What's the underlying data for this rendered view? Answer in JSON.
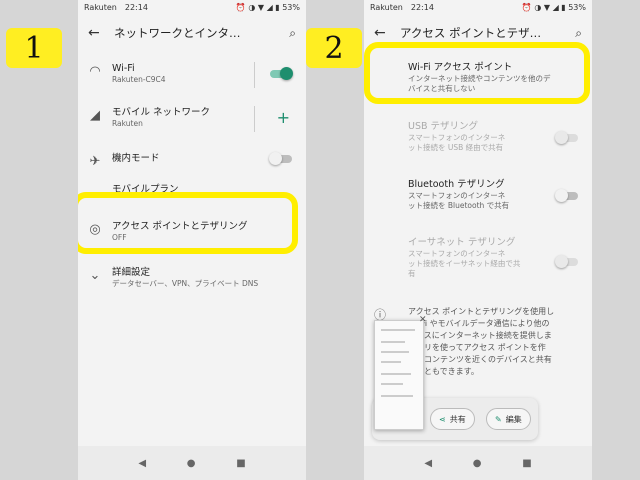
{
  "badges": [
    "1",
    "2"
  ],
  "status_bar": {
    "carrier": "Rakuten",
    "time": "22:14",
    "icons": "⏰ ◑ ▼ ◢ ▮ 53%"
  },
  "nav": {
    "back": "◀",
    "home": "●",
    "recents": "■"
  },
  "panel1": {
    "title": "ネットワークとインタ…",
    "wifi": {
      "title": "Wi-Fi",
      "subtitle": "Rakuten-C9C4",
      "toggle": "on"
    },
    "mobile": {
      "title": "モバイル ネットワーク",
      "subtitle": "Rakuten"
    },
    "airplane": {
      "title": "機内モード",
      "toggle": "off"
    },
    "mobile_plan": {
      "title": "モバイルプラン"
    },
    "hotspot": {
      "title": "アクセス ポイントとテザリング",
      "subtitle": "OFF"
    },
    "advanced": {
      "title": "詳細設定",
      "subtitle": "データセーバー、VPN、プライベート DNS"
    }
  },
  "panel2": {
    "title": "アクセス ポイントとテザ…",
    "wifi_hotspot": {
      "title": "Wi-Fi アクセス ポイント",
      "subtitle1": "インターネット接続やコンテンツを他のデ",
      "subtitle2": "バイスと共有しない"
    },
    "usb": {
      "title": "USB テザリング",
      "subtitle1": "スマートフォンのインターネ",
      "subtitle2": "ット接続を USB 経由で共有",
      "toggle": "off"
    },
    "bluetooth": {
      "title": "Bluetooth テザリング",
      "subtitle1": "スマートフォンのインターネ",
      "subtitle2": "ット接続を Bluetooth で共有",
      "toggle": "off"
    },
    "ethernet": {
      "title": "イーサネット テザリング",
      "subtitle1": "スマートフォンのインターネ",
      "subtitle2": "ット接続をイーサネット経由で共",
      "subtitle3": "有",
      "toggle": "off"
    },
    "info_lines": [
      "アクセス ポイントとテザリングを使用し",
      "Wi-Fi やモバイルデータ通信により他の",
      "バイスにインターネット接続を提供しま",
      "アプリを使ってアクセス ポイントを作",
      "し、コンテンツを近くのデバイスと共有",
      "ることもできます。"
    ],
    "share_label": "共有",
    "edit_label": "編集"
  },
  "colors": {
    "highlight": "#ffee00",
    "accent": "#1e8e6e"
  }
}
